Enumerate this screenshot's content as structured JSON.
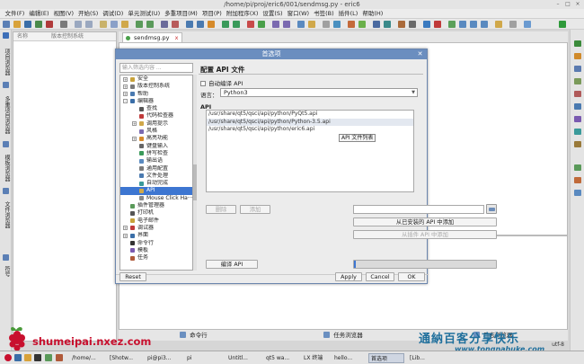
{
  "window": {
    "title": "/home/pi/proj/eric6/001/sendmsg.py - eric6",
    "controls": [
      "–",
      "□",
      "×"
    ]
  },
  "menubar": [
    "文件(F)",
    "编辑(E)",
    "视图(V)",
    "开始(S)",
    "调试(D)",
    "单元测试(U)",
    "多重项目(M)",
    "项目(P)",
    "附加程序(X)",
    "设置(S)",
    "窗口(W)",
    "书签(B)",
    "插件(L)",
    "帮助(H)"
  ],
  "left_sidebar": [
    "项目浏览器",
    "多重项目浏览器",
    "模板浏览器",
    "文件浏览器",
    "符号"
  ],
  "project_panel": {
    "col_name": "名称",
    "col_vcs": "版本控制系统"
  },
  "editor": {
    "tab_label": "sendmsg.py",
    "tab_close": "x"
  },
  "bottom_tabs": [
    "命令行",
    "任务浏览器",
    "日志浏览器"
  ],
  "status": {
    "encoding": "utf-8"
  },
  "taskbar": [
    "/home/...",
    "[Shotw...",
    "pi@pi3...",
    "pi",
    "Untitl...",
    "qt5 wa...",
    "LX 终端",
    "hello...",
    "首选项",
    "[Lib..."
  ],
  "branding": {
    "site": "shumeipai.nxez.com",
    "watermark_cn": "通納百客分享快乐",
    "watermark_en": "www.tongnabuke.com"
  },
  "dialog": {
    "title": "首选项",
    "search_placeholder": "输入筛选内容 ...",
    "tree": [
      {
        "label": "安全",
        "indent": 0,
        "expander": "+",
        "icon": "shield"
      },
      {
        "label": "版本控制系统",
        "indent": 0,
        "expander": "+",
        "icon": "vcs"
      },
      {
        "label": "帮助",
        "indent": 0,
        "expander": "+",
        "icon": "help"
      },
      {
        "label": "编辑器",
        "indent": 0,
        "expander": "-",
        "icon": "editor"
      },
      {
        "label": "查找",
        "indent": 1,
        "expander": "",
        "icon": "find"
      },
      {
        "label": "代码检查器",
        "indent": 1,
        "expander": "",
        "icon": "checker"
      },
      {
        "label": "调用提示",
        "indent": 1,
        "expander": "+",
        "icon": "calltip"
      },
      {
        "label": "风格",
        "indent": 1,
        "expander": "",
        "icon": "style"
      },
      {
        "label": "高亮功能",
        "indent": 1,
        "expander": "+",
        "icon": "highlight"
      },
      {
        "label": "键盘输入",
        "indent": 1,
        "expander": "",
        "icon": "keyboard"
      },
      {
        "label": "拼写检查",
        "indent": 1,
        "expander": "",
        "icon": "spell"
      },
      {
        "label": "输出语",
        "indent": 1,
        "expander": "",
        "icon": "output"
      },
      {
        "label": "通用配置",
        "indent": 1,
        "expander": "",
        "icon": "general"
      },
      {
        "label": "文件处理",
        "indent": 1,
        "expander": "",
        "icon": "file"
      },
      {
        "label": "自动完成",
        "indent": 1,
        "expander": "",
        "icon": "autocomplete"
      },
      {
        "label": "API",
        "indent": 1,
        "expander": "",
        "icon": "api",
        "selected": true
      },
      {
        "label": "Mouse Click Ha···",
        "indent": 1,
        "expander": "",
        "icon": "mouse"
      },
      {
        "label": "插件管理器",
        "indent": 0,
        "expander": "",
        "icon": "plugin"
      },
      {
        "label": "打印机",
        "indent": 0,
        "expander": "",
        "icon": "printer"
      },
      {
        "label": "电子邮件",
        "indent": 0,
        "expander": "",
        "icon": "mail"
      },
      {
        "label": "调试器",
        "indent": 0,
        "expander": "+",
        "icon": "debugger"
      },
      {
        "label": "界面",
        "indent": 0,
        "expander": "+",
        "icon": "interface"
      },
      {
        "label": "命令行",
        "indent": 0,
        "expander": "",
        "icon": "shell"
      },
      {
        "label": "模板",
        "indent": 0,
        "expander": "",
        "icon": "template"
      },
      {
        "label": "任务",
        "indent": 0,
        "expander": "",
        "icon": "task"
      }
    ],
    "section_title": "配置 API 文件",
    "auto_compile_label": "自动编译 API",
    "auto_compile_checked": false,
    "language_label": "语言：",
    "language_value": "Python3",
    "api_label": "API",
    "api_files": [
      "/usr/share/qt5/qsci/api/python/PyQt5.api",
      "/usr/share/qt5/qsci/api/python/Python-3.5.api",
      "/usr/share/qt5/qsci/api/python/eric6.api"
    ],
    "tooltip": "API 文件列表",
    "delete_btn": "删除",
    "add_btn": "添加",
    "add_installed_btn": "从已安装的 API 中添加",
    "add_plugin_btn": "从插件 API 中添加",
    "compile_btn": "编译 API",
    "compile_progress": 0,
    "reset_btn": "Reset",
    "apply_btn": "Apply",
    "cancel_btn": "Cancel",
    "ok_btn": "OK"
  }
}
